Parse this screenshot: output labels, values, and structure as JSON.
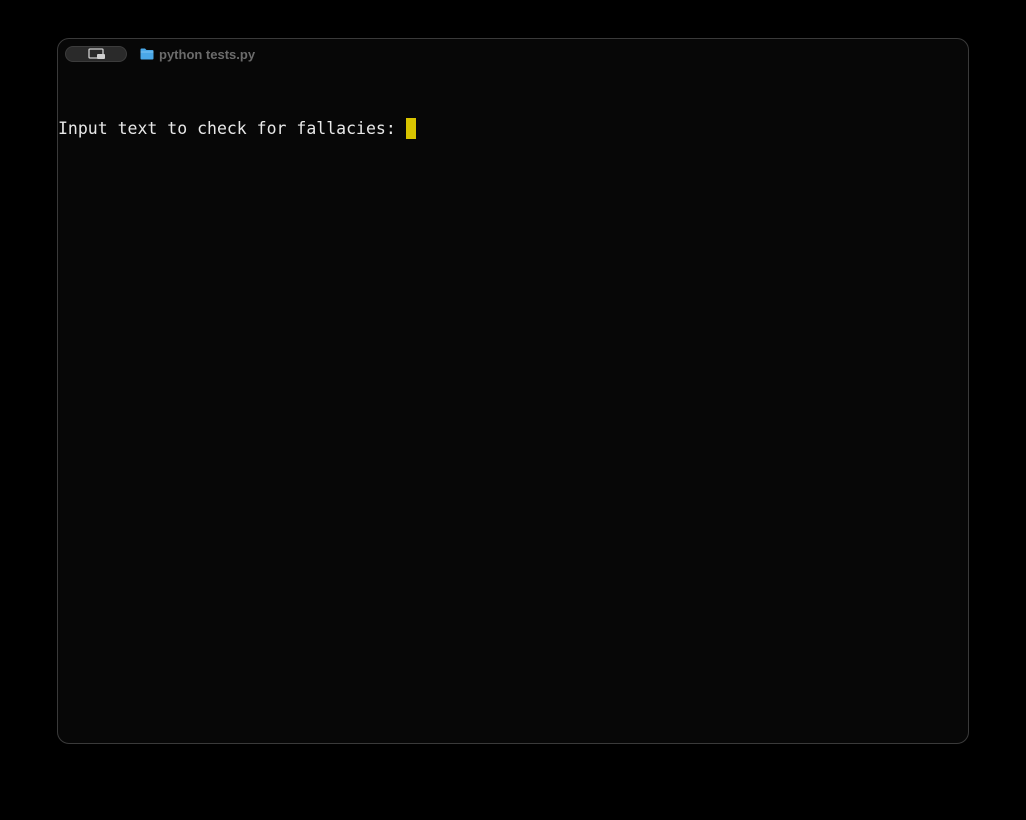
{
  "window": {
    "tab_title": "python tests.py",
    "icons": {
      "window_switcher": "terminal-window-icon",
      "tab": "folder-icon"
    }
  },
  "terminal": {
    "prompt_text": "Input text to check for fallacies: ",
    "input_value": "",
    "cursor_color": "#d8c400"
  },
  "colors": {
    "background": "#000000",
    "window_background": "#070707",
    "text": "#e8e8e8",
    "tab_text": "#6b6b6b",
    "folder_icon": "#4aa8e8"
  }
}
